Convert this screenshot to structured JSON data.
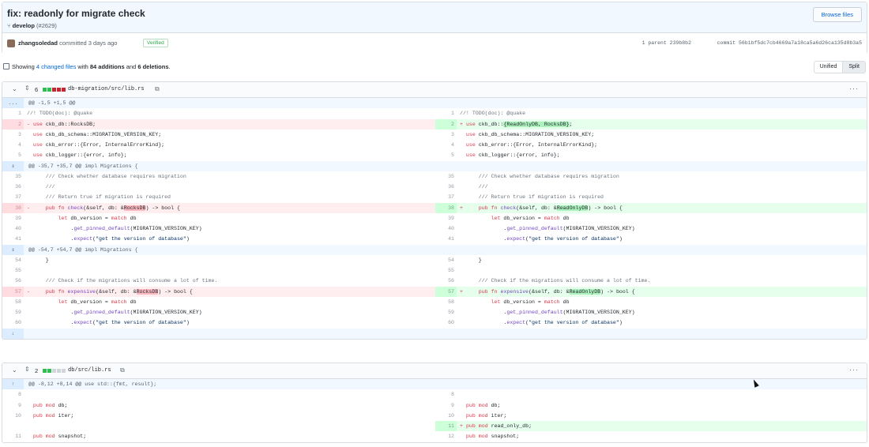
{
  "commit": {
    "title": "fix: readonly for migrate check",
    "branch": "develop",
    "pr": "(#2629)",
    "browse_label": "Browse files",
    "author": "zhangsoledad",
    "committed_text": "committed 3 days ago",
    "verified": "Verified",
    "parent_text": "1 parent 239b8b2",
    "commit_text": "commit 56b1bf5dc7cb4669a7a18ca5a6d26ca135d8b3a5"
  },
  "toc": {
    "prefix": "Showing",
    "files_link": "4 changed files",
    "with": "with",
    "additions": "84 additions",
    "and": "and",
    "deletions": "6 deletions",
    "period": ".",
    "unified": "Unified",
    "split": "Split"
  },
  "colors": {
    "added": "#2cbe4e",
    "removed": "#cb2431",
    "neutral": "#d1d5da",
    "accent": "#0366d6"
  },
  "icons": {
    "branch": "git-branch-icon",
    "expand": "expand-icon",
    "copy": "clipboard-icon",
    "more": "kebab-icon"
  },
  "files": [
    {
      "count": "6",
      "path": "db-migration/src/lib.rs",
      "bar": [
        "g",
        "g",
        "r",
        "r",
        "r"
      ],
      "rows": [
        {
          "t": "hunk",
          "exp": "...",
          "text": "@@ -1,5 +1,5 @@"
        },
        {
          "t": "row",
          "l": {
            "n": "1",
            "c": "//! TODO(doc): @quake",
            "k": "ctx"
          },
          "r": {
            "n": "1",
            "c": "//! TODO(doc): @quake",
            "k": "ctx"
          }
        },
        {
          "t": "row",
          "l": {
            "n": "2",
            "c": "- use ckb_db::RocksDB;",
            "k": "del"
          },
          "r": {
            "n": "2",
            "c": "+ use ckb_db::{ReadOnlyDB, RocksDB};",
            "k": "add"
          }
        },
        {
          "t": "row",
          "l": {
            "n": "3",
            "c": "  use ckb_db_schema::MIGRATION_VERSION_KEY;",
            "k": "ctx"
          },
          "r": {
            "n": "3",
            "c": "  use ckb_db_schema::MIGRATION_VERSION_KEY;",
            "k": "ctx"
          }
        },
        {
          "t": "row",
          "l": {
            "n": "4",
            "c": "  use ckb_error::{Error, InternalErrorKind};",
            "k": "ctx"
          },
          "r": {
            "n": "4",
            "c": "  use ckb_error::{Error, InternalErrorKind};",
            "k": "ctx"
          }
        },
        {
          "t": "row",
          "l": {
            "n": "5",
            "c": "  use ckb_logger::{error, info};",
            "k": "ctx"
          },
          "r": {
            "n": "5",
            "c": "  use ckb_logger::{error, info};",
            "k": "ctx"
          }
        },
        {
          "t": "hunk",
          "exp": "⇕",
          "text": "@@ -35,7 +35,7 @@ impl Migrations {"
        },
        {
          "t": "row",
          "l": {
            "n": "35",
            "c": "      /// Check whether database requires migration",
            "k": "ctx"
          },
          "r": {
            "n": "35",
            "c": "      /// Check whether database requires migration",
            "k": "ctx"
          }
        },
        {
          "t": "row",
          "l": {
            "n": "36",
            "c": "      ///",
            "k": "ctx"
          },
          "r": {
            "n": "36",
            "c": "      ///",
            "k": "ctx"
          }
        },
        {
          "t": "row",
          "l": {
            "n": "37",
            "c": "      /// Return true if migration is required",
            "k": "ctx"
          },
          "r": {
            "n": "37",
            "c": "      /// Return true if migration is required",
            "k": "ctx"
          }
        },
        {
          "t": "row",
          "l": {
            "n": "38",
            "c": "-     pub fn check(&self, db: &RocksDB) -> bool {",
            "k": "del"
          },
          "r": {
            "n": "38",
            "c": "+     pub fn check(&self, db: &ReadOnlyDB) -> bool {",
            "k": "add"
          }
        },
        {
          "t": "row",
          "l": {
            "n": "39",
            "c": "          let db_version = match db",
            "k": "ctx"
          },
          "r": {
            "n": "39",
            "c": "          let db_version = match db",
            "k": "ctx"
          }
        },
        {
          "t": "row",
          "l": {
            "n": "40",
            "c": "              .get_pinned_default(MIGRATION_VERSION_KEY)",
            "k": "ctx"
          },
          "r": {
            "n": "40",
            "c": "              .get_pinned_default(MIGRATION_VERSION_KEY)",
            "k": "ctx"
          }
        },
        {
          "t": "row",
          "l": {
            "n": "41",
            "c": "              .expect(\"get the version of database\")",
            "k": "ctx"
          },
          "r": {
            "n": "41",
            "c": "              .expect(\"get the version of database\")",
            "k": "ctx"
          }
        },
        {
          "t": "hunk",
          "exp": "⇕",
          "text": "@@ -54,7 +54,7 @@ impl Migrations {"
        },
        {
          "t": "row",
          "l": {
            "n": "54",
            "c": "      }",
            "k": "ctx"
          },
          "r": {
            "n": "54",
            "c": "      }",
            "k": "ctx"
          }
        },
        {
          "t": "row",
          "l": {
            "n": "55",
            "c": "",
            "k": "ctx"
          },
          "r": {
            "n": "55",
            "c": "",
            "k": "ctx"
          }
        },
        {
          "t": "row",
          "l": {
            "n": "56",
            "c": "      /// Check if the migrations will consume a lot of time.",
            "k": "ctx"
          },
          "r": {
            "n": "56",
            "c": "      /// Check if the migrations will consume a lot of time.",
            "k": "ctx"
          }
        },
        {
          "t": "row",
          "l": {
            "n": "57",
            "c": "-     pub fn expensive(&self, db: &RocksDB) -> bool {",
            "k": "del"
          },
          "r": {
            "n": "57",
            "c": "+     pub fn expensive(&self, db: &ReadOnlyDB) -> bool {",
            "k": "add"
          }
        },
        {
          "t": "row",
          "l": {
            "n": "58",
            "c": "          let db_version = match db",
            "k": "ctx"
          },
          "r": {
            "n": "58",
            "c": "          let db_version = match db",
            "k": "ctx"
          }
        },
        {
          "t": "row",
          "l": {
            "n": "59",
            "c": "              .get_pinned_default(MIGRATION_VERSION_KEY)",
            "k": "ctx"
          },
          "r": {
            "n": "59",
            "c": "              .get_pinned_default(MIGRATION_VERSION_KEY)",
            "k": "ctx"
          }
        },
        {
          "t": "row",
          "l": {
            "n": "60",
            "c": "              .expect(\"get the version of database\")",
            "k": "ctx"
          },
          "r": {
            "n": "60",
            "c": "              .expect(\"get the version of database\")",
            "k": "ctx"
          }
        },
        {
          "t": "exp",
          "exp": "↓"
        }
      ]
    },
    {
      "count": "2",
      "path": "db/src/lib.rs",
      "bar": [
        "g",
        "g",
        "n",
        "n",
        "n"
      ],
      "rows": [
        {
          "t": "hunk",
          "exp": "↑",
          "text": "@@ -8,12 +8,14 @@ use std::{fmt, result};"
        },
        {
          "t": "row",
          "l": {
            "n": "8",
            "c": "",
            "k": "ctx"
          },
          "r": {
            "n": "8",
            "c": "",
            "k": "ctx"
          }
        },
        {
          "t": "row",
          "l": {
            "n": "9",
            "c": "  pub mod db;",
            "k": "ctx"
          },
          "r": {
            "n": "9",
            "c": "  pub mod db;",
            "k": "ctx"
          }
        },
        {
          "t": "row",
          "l": {
            "n": "10",
            "c": "  pub mod iter;",
            "k": "ctx"
          },
          "r": {
            "n": "10",
            "c": "  pub mod iter;",
            "k": "ctx"
          }
        },
        {
          "t": "row",
          "l": {
            "n": "",
            "c": "",
            "k": "empty"
          },
          "r": {
            "n": "11",
            "c": "+ pub mod read_only_db;",
            "k": "add"
          }
        },
        {
          "t": "row",
          "l": {
            "n": "11",
            "c": "  pub mod snapshot;",
            "k": "ctx"
          },
          "r": {
            "n": "12",
            "c": "  pub mod snapshot;",
            "k": "ctx"
          }
        }
      ]
    }
  ]
}
